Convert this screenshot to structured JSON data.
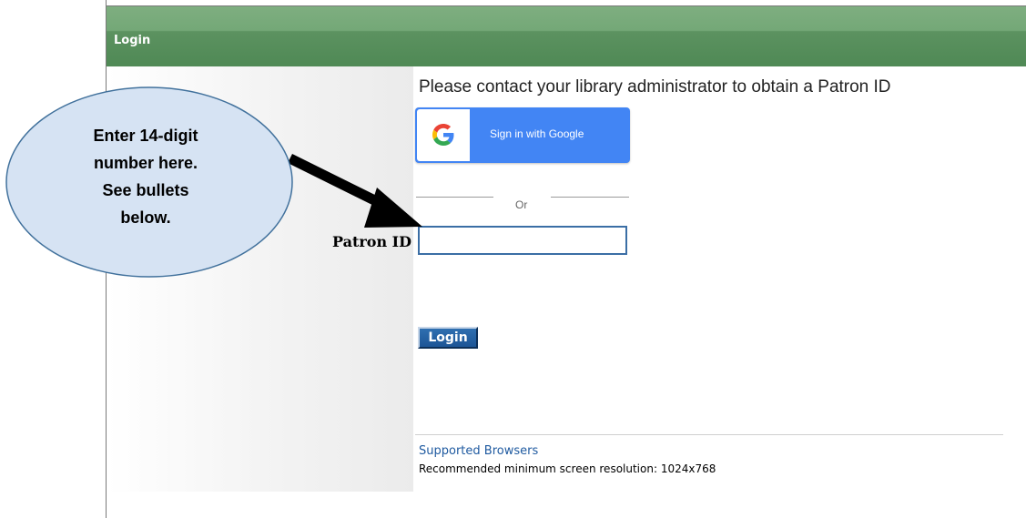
{
  "header": {
    "title": "Login"
  },
  "main": {
    "instruction": "Please contact your library administrator to obtain a Patron ID",
    "google_button": {
      "label": "Sign in with Google"
    },
    "divider_text": "Or",
    "patron_id": {
      "label": "Patron ID",
      "value": ""
    },
    "login_button": {
      "label": "Login"
    }
  },
  "footer": {
    "supported_browsers": "Supported Browsers",
    "resolution": "Recommended minimum screen resolution: 1024x768"
  },
  "annotation": {
    "lines": [
      "Enter 14-digit",
      "number here.",
      "See bullets",
      "below."
    ]
  },
  "colors": {
    "header_green": "#4f8955",
    "google_blue": "#4285f4",
    "login_blue": "#1d5596",
    "link_blue": "#1f5aa0",
    "callout_fill": "#d6e3f3",
    "callout_border": "#41719c"
  }
}
